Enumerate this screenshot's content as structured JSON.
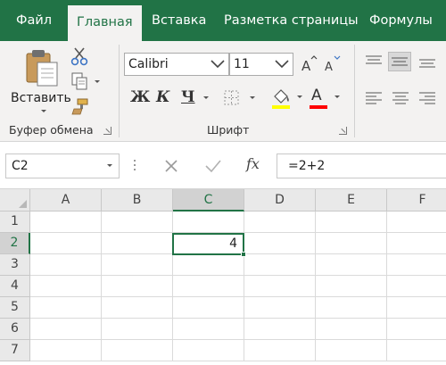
{
  "ribbon_tabs": [
    {
      "label": "Файл"
    },
    {
      "label": "Главная",
      "active": true
    },
    {
      "label": "Вставка"
    },
    {
      "label": "Разметка страницы"
    },
    {
      "label": "Формулы"
    }
  ],
  "clipboard": {
    "paste_label": "Вставить",
    "group_label": "Буфер обмена",
    "icons": [
      "paste-icon",
      "cut-icon",
      "copy-icon",
      "format-painter-icon"
    ]
  },
  "font": {
    "font_name": "Calibri",
    "font_size": "11",
    "bold": "Ж",
    "italic": "К",
    "underline": "Ч",
    "font_color_glyph": "A",
    "group_label": "Шрифт",
    "highlight_color": "#ffff00",
    "font_color": "#ff0000"
  },
  "formula_bar": {
    "name_box": "C2",
    "fx": "fx",
    "formula": "=2+2"
  },
  "grid": {
    "columns": [
      "A",
      "B",
      "C",
      "D",
      "E",
      "F"
    ],
    "rows": [
      "1",
      "2",
      "3",
      "4",
      "5",
      "6",
      "7"
    ],
    "selected_column": "C",
    "selected_row": "2",
    "active_cell_value": "4"
  },
  "colors": {
    "accent": "#217346",
    "ribbon_bg": "#f3f2f1"
  }
}
